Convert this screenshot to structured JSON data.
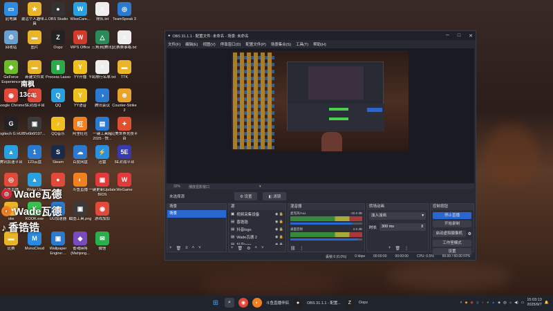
{
  "desktop": {
    "icons": [
      {
        "label": "此电脑",
        "color": "#2f8be0",
        "glyph": "▭"
      },
      {
        "label": "激活个人趣味工具",
        "color": "#e9b42a",
        "glyph": "★"
      },
      {
        "label": "OBS Studio",
        "color": "#333",
        "glyph": "●"
      },
      {
        "label": "WiseCare...",
        "color": "#2aa0e0",
        "glyph": "W"
      },
      {
        "label": "排队.txt",
        "color": "#eee",
        "glyph": "≡"
      },
      {
        "label": "TeamSpeak 3",
        "color": "#2a7ad0",
        "glyph": "◎"
      },
      {
        "label": "回收站",
        "color": "#6aa0d0",
        "glyph": "♲"
      },
      {
        "label": "图片",
        "color": "#e9b42a",
        "glyph": "▬"
      },
      {
        "label": "Oopz",
        "color": "#222",
        "glyph": "Z"
      },
      {
        "label": "WPS Office",
        "color": "#d23a2a",
        "glyph": "W"
      },
      {
        "label": "三角洲(腾讯)",
        "color": "#2a8a5a",
        "glyph": "△"
      },
      {
        "label": "比赛赛事格.txt",
        "color": "#eee",
        "glyph": "≡"
      },
      {
        "label": "GeForce Experience",
        "color": "#6cbb2a",
        "glyph": "◆"
      },
      {
        "label": "新建文件夹",
        "color": "#e9b42a",
        "glyph": "▬"
      },
      {
        "label": "Process Lasso",
        "color": "#2aaa4a",
        "glyph": "▮"
      },
      {
        "label": "YY开播",
        "color": "#f0c020",
        "glyph": "Y"
      },
      {
        "label": "Y出排行名单.txt",
        "color": "#eee",
        "glyph": "≡"
      },
      {
        "label": "TTK",
        "color": "#e9b42a",
        "glyph": "▬"
      },
      {
        "label": "Google Chrome",
        "color": "#e04a3a",
        "glyph": "◉"
      },
      {
        "label": "SE对战平台",
        "color": "#e04a3a",
        "glyph": "S"
      },
      {
        "label": "QQ",
        "color": "#2aa0e0",
        "glyph": "Q"
      },
      {
        "label": "YY语音",
        "color": "#f0c020",
        "glyph": "Y"
      },
      {
        "label": "腾讯会议",
        "color": "#2a7ad0",
        "glyph": "◑"
      },
      {
        "label": "Counter-Strike 2",
        "color": "#e9a22a",
        "glyph": "⊕"
      },
      {
        "label": "Logitech G HUB",
        "color": "#222",
        "glyph": "G"
      },
      {
        "label": "7e6b6f197...",
        "color": "#3a3a3a",
        "glyph": "▣"
      },
      {
        "label": "QQ音乐",
        "color": "#f0c020",
        "glyph": "♪"
      },
      {
        "label": "阿里旺旺",
        "color": "#f08020",
        "glyph": "旺"
      },
      {
        "label": "一键工具箱 2025 - 快...",
        "color": "#2a7ad0",
        "glyph": "▤"
      },
      {
        "label": "完美世界竞技平台",
        "color": "#e05030",
        "glyph": "✦"
      },
      {
        "label": "腾讯加速平台",
        "color": "#2aa0e0",
        "glyph": "▲"
      },
      {
        "label": "123云盘",
        "color": "#2a7ad0",
        "glyph": "1"
      },
      {
        "label": "Steam",
        "color": "#1a2a4a",
        "glyph": "S"
      },
      {
        "label": "百度网盘",
        "color": "#2a7ad0",
        "glyph": "☁"
      },
      {
        "label": "迅雷",
        "color": "#2a90e0",
        "glyph": "⚡"
      },
      {
        "label": "5E对战平台",
        "color": "#3a3ab0",
        "glyph": "5E"
      },
      {
        "label": "斗鱼直播",
        "color": "#e04a3a",
        "glyph": "◎"
      },
      {
        "label": "Wake Up",
        "color": "#2aa0e0",
        "glyph": "▲"
      },
      {
        "label": "",
        "color": "#e04a3a",
        "glyph": "●"
      },
      {
        "label": "斗鱼直播",
        "color": "#f08020",
        "glyph": "◐"
      },
      {
        "label": "一键更新Update BIOS",
        "color": "#e03a3a",
        "glyph": "▣"
      },
      {
        "label": "WeGame",
        "color": "#e03a3a",
        "glyph": "W"
      },
      {
        "label": "obs",
        "color": "#e9b42a",
        "glyph": "▬"
      },
      {
        "label": "KOOK.exe",
        "color": "#3ac050",
        "glyph": "K"
      },
      {
        "label": "UU加速器",
        "color": "#2a7ad0",
        "glyph": "U"
      },
      {
        "label": "截图工具.png",
        "color": "#3a3a3a",
        "glyph": "▣"
      },
      {
        "label": "游戏加加",
        "color": "#e04a3a",
        "glyph": "◉"
      },
      {
        "label": "",
        "color": "#3a3a3a",
        "glyph": ""
      },
      {
        "label": "比赛",
        "color": "#e9b42a",
        "glyph": "▬"
      },
      {
        "label": "MonoCloud",
        "color": "#2a8ae0",
        "glyph": "M"
      },
      {
        "label": "Wallpaper Engine:...",
        "color": "#2a7ad0",
        "glyph": "▣"
      },
      {
        "label": "雀魂麻将(Mahjong...",
        "color": "#7a4ac0",
        "glyph": "◆"
      },
      {
        "label": "微信",
        "color": "#2ab04a",
        "glyph": "✉"
      }
    ],
    "overlay": {
      "line1": "13ca",
      "line2": "南枫",
      "wade1": "Wade瓦德",
      "wade2": "Wade瓦德",
      "tiktok": "香锆锆"
    }
  },
  "obs": {
    "title": "OBS 31.1.1 - 配置文件: 未命名 - 场景: 未命名",
    "menu": [
      "文件(F)",
      "编辑(E)",
      "视图(V)",
      "停靠窗口(D)",
      "配置文件(P)",
      "场景集合(S)",
      "工具(T)",
      "帮助(H)"
    ],
    "preview_zoom": "32%",
    "preview_zoom_label": "播放显影窗口",
    "no_source": "未选择源",
    "btn_properties": "设置",
    "btn_filters": "滤镜",
    "docks": {
      "scenes": {
        "title": "场景",
        "items": [
          "场景"
        ]
      },
      "sources": {
        "title": "源",
        "items": [
          "视频采集设备",
          "香锆锆",
          "抖音logo",
          "Wade瓦德 2",
          "抖音logo",
          "Wade瓦德",
          "抖音logo",
          "斗鱼logo"
        ]
      },
      "mixer": {
        "title": "混音器",
        "ch1_name": "麦克风/Aux",
        "ch1_db": "-20.0 dB",
        "ch2_name": "桌面音频",
        "ch2_db": "0.0 dB"
      },
      "transitions": {
        "title": "转场动画",
        "type": "淡入淡出",
        "duration_label": "时长",
        "duration": "300 ms"
      },
      "controls": {
        "title": "控制按钮",
        "buttons": [
          "停止直播",
          "开始录制",
          "启动虚拟摄像机",
          "工作室模式",
          "设置",
          "退出"
        ]
      }
    },
    "status": {
      "frames": "丢帧 0 (0.0%)",
      "kbps": "0 kbps",
      "rec": "00:00:00",
      "stream": "00:00:00",
      "cpu": "CPU: 0.5%",
      "fps": "60.00 / 60.00 FPS"
    }
  },
  "taskbar": {
    "apps": [
      {
        "label": "斗鱼直播伴侣"
      },
      {
        "label": "OBS 31.1.1 - 配置..."
      },
      {
        "label": "Oopz"
      }
    ],
    "time": "15:03:13",
    "date": "2025/9/7",
    "ime": "中"
  }
}
